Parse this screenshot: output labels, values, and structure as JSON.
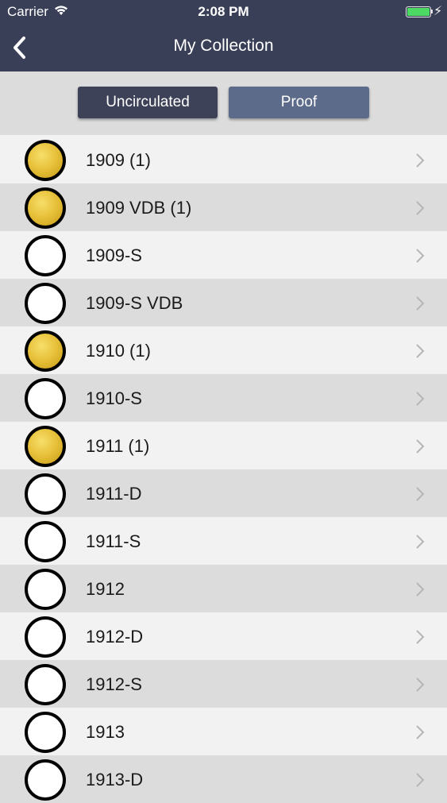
{
  "status_bar": {
    "carrier": "Carrier",
    "time": "2:08 PM",
    "battery_color": "#4cd964",
    "icons": [
      "wifi-icon",
      "battery-icon",
      "charging-bolt-icon"
    ]
  },
  "nav": {
    "title": "My Collection",
    "back_icon": "chevron-left-icon",
    "background": "#3a3f58"
  },
  "segments": {
    "uncirculated": "Uncirculated",
    "proof": "Proof",
    "selected": "Uncirculated"
  },
  "rows": [
    {
      "label": "1909 (1)",
      "owned": true
    },
    {
      "label": "1909 VDB (1)",
      "owned": true
    },
    {
      "label": "1909-S",
      "owned": false
    },
    {
      "label": "1909-S VDB",
      "owned": false
    },
    {
      "label": "1910 (1)",
      "owned": true
    },
    {
      "label": "1910-S",
      "owned": false
    },
    {
      "label": "1911 (1)",
      "owned": true
    },
    {
      "label": "1911-D",
      "owned": false
    },
    {
      "label": "1911-S",
      "owned": false
    },
    {
      "label": "1912",
      "owned": false
    },
    {
      "label": "1912-D",
      "owned": false
    },
    {
      "label": "1912-S",
      "owned": false
    },
    {
      "label": "1913",
      "owned": false
    },
    {
      "label": "1913-D",
      "owned": false
    }
  ],
  "colors": {
    "coin_owned": "#e8c23c",
    "coin_empty": "#ffffff",
    "row_light": "#f2f2f2",
    "row_dark": "#dcdcdc"
  }
}
